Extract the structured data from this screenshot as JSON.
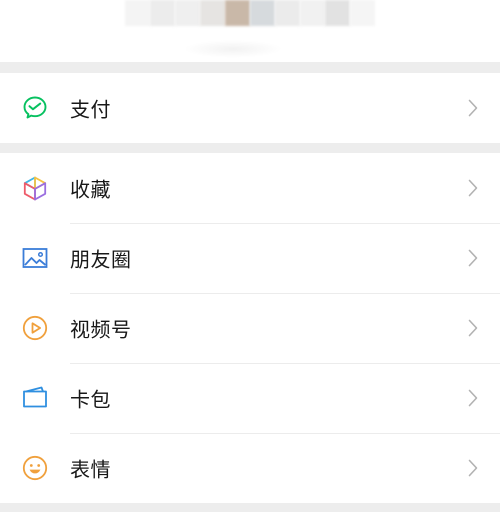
{
  "colors": {
    "page_bg": "#ededed",
    "row_bg": "#ffffff",
    "text": "#181818",
    "chevron": "#b2b2b2",
    "pay_icon": "#07c160",
    "moments_icon": "#3b7dd8",
    "channels_icon": "#f0a03c",
    "cards_icon": "#2f8fe0",
    "emoji_icon": "#f0a03c"
  },
  "pay_section": {
    "items": [
      {
        "label": "支付",
        "icon": "pay-icon"
      }
    ]
  },
  "feature_section": {
    "items": [
      {
        "label": "收藏",
        "icon": "favorites-icon"
      },
      {
        "label": "朋友圈",
        "icon": "moments-icon"
      },
      {
        "label": "视频号",
        "icon": "channels-icon"
      },
      {
        "label": "卡包",
        "icon": "cards-icon"
      },
      {
        "label": "表情",
        "icon": "emoji-icon"
      }
    ]
  }
}
